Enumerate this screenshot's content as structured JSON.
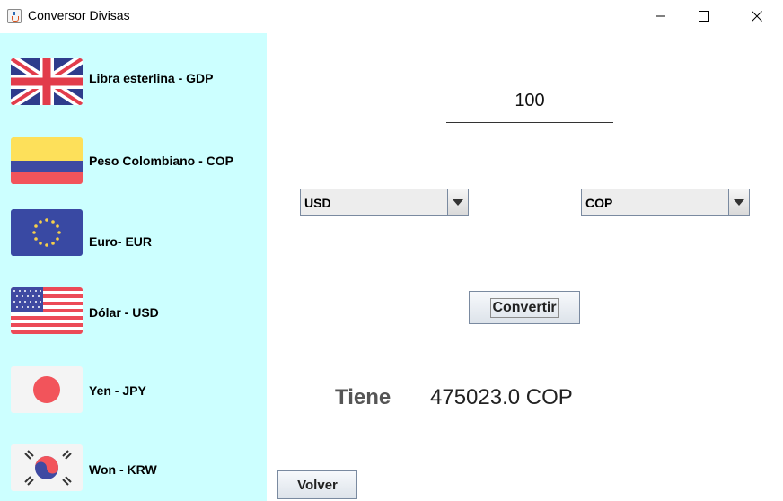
{
  "window": {
    "title": "Conversor Divisas",
    "controls": [
      "minimize",
      "maximize",
      "close"
    ]
  },
  "sidebar": {
    "items": [
      {
        "label": "Libra esterlina - GDP",
        "flag_icon": "uk-flag-icon"
      },
      {
        "label": "Peso Colombiano - COP",
        "flag_icon": "colombia-flag-icon"
      },
      {
        "label": "Euro- EUR",
        "flag_icon": "eu-flag-icon"
      },
      {
        "label": "Dólar - USD",
        "flag_icon": "usa-flag-icon"
      },
      {
        "label": "Yen - JPY",
        "flag_icon": "japan-flag-icon"
      },
      {
        "label": "Won - KRW",
        "flag_icon": "korea-flag-icon"
      }
    ],
    "background": "#ccffff"
  },
  "converter": {
    "amount": "100",
    "from_currency": "USD",
    "to_currency": "COP",
    "convert_label": "Convertir",
    "result_label": "Tiene",
    "result_value": "475023.0 COP"
  },
  "footer": {
    "back_label": "Volver"
  }
}
